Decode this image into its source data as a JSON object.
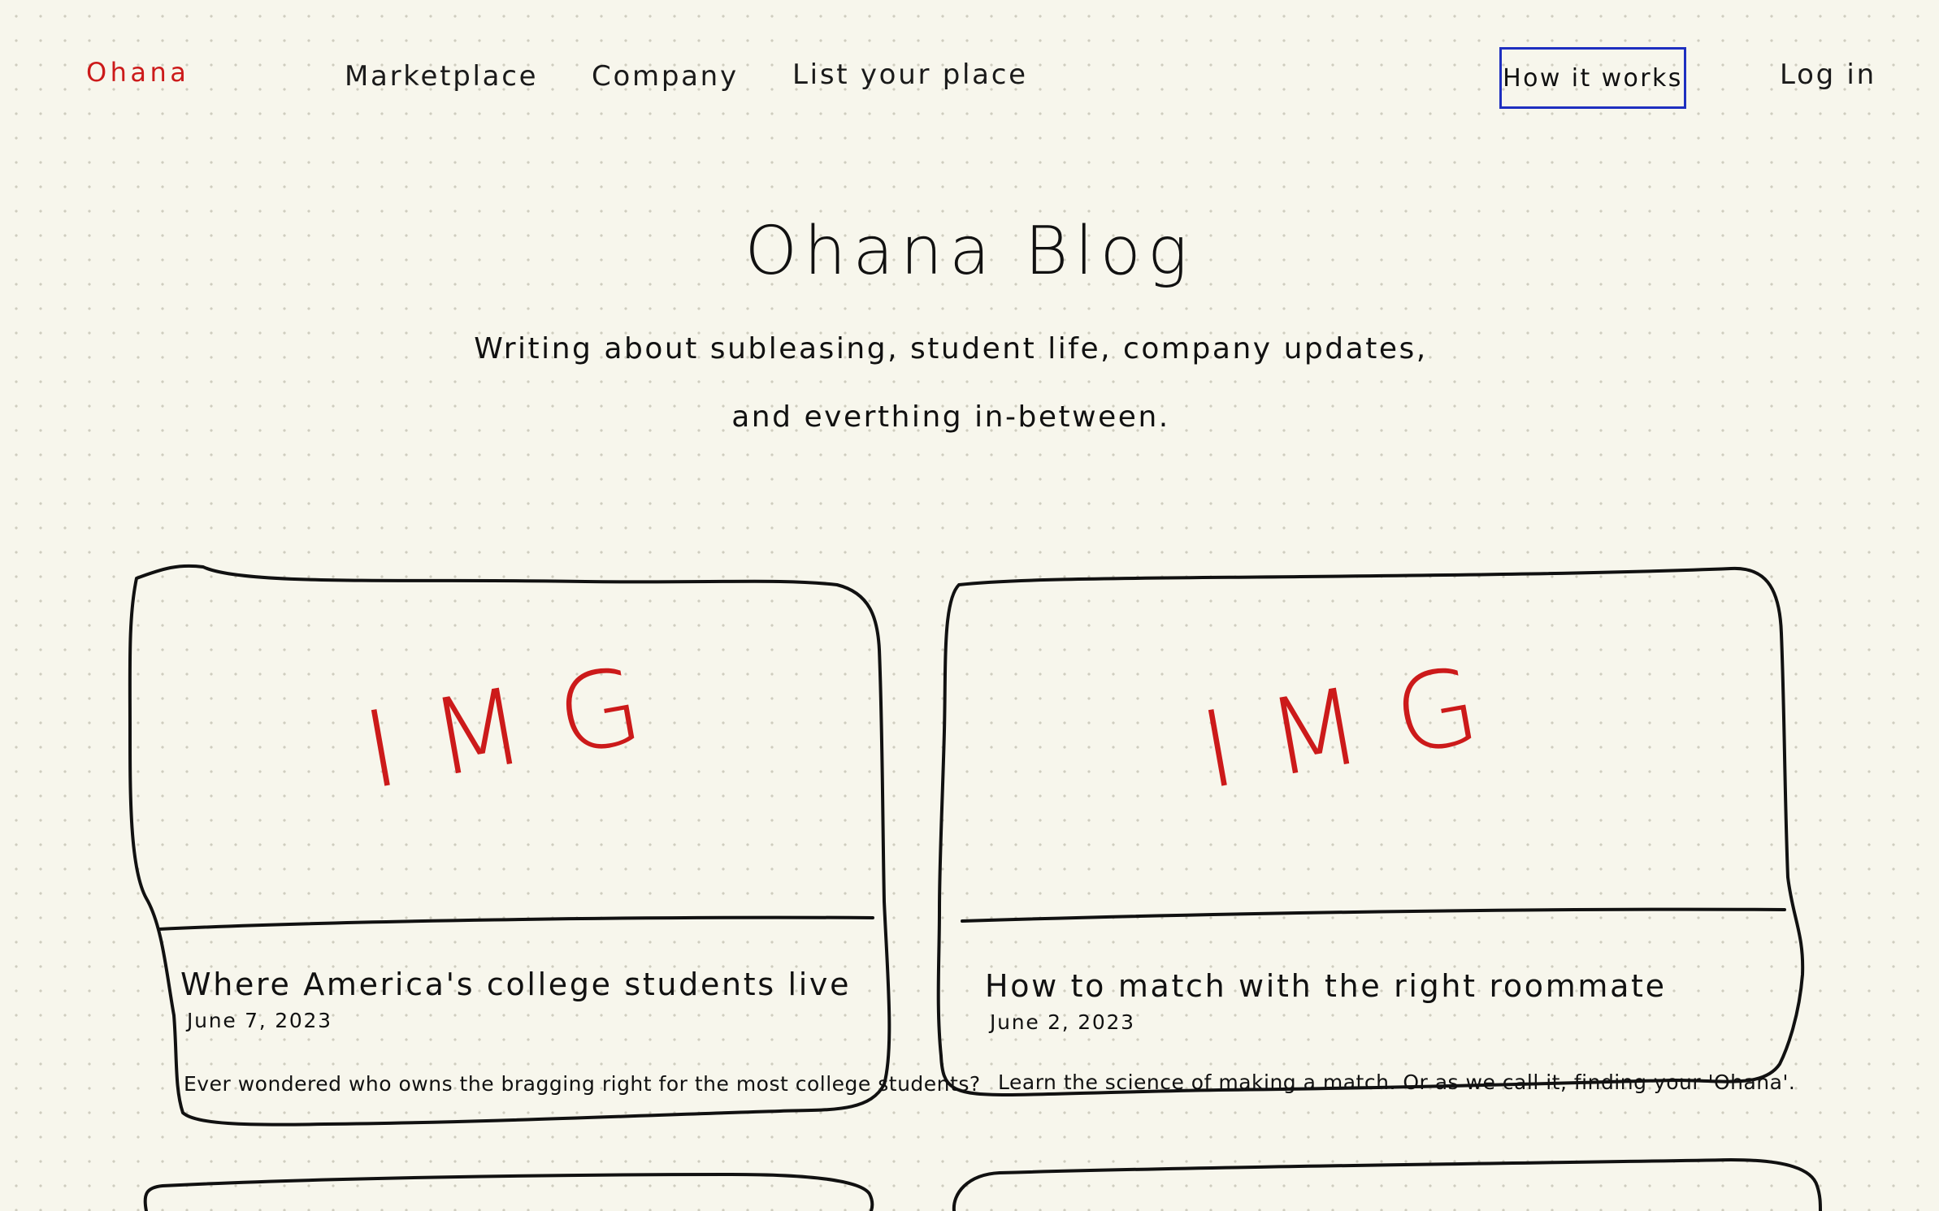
{
  "nav": {
    "logo": "Ohana",
    "links": [
      "Marketplace",
      "Company",
      "List your place"
    ],
    "how_it_works": "How it works",
    "login": "Log in"
  },
  "hero": {
    "title": "Ohana Blog",
    "subtitle": "Writing about subleasing, student life, company updates, and everthing in-between."
  },
  "posts": [
    {
      "image_label": "IMG",
      "title": "Where America's college students live",
      "date": "June 7, 2023",
      "excerpt": "Ever wondered who owns the bragging right for the most college students?"
    },
    {
      "image_label": "IMG",
      "title": "How to match with the right roommate",
      "date": "June 2, 2023",
      "excerpt": "Learn the science of making a match. Or as we call it, finding your 'Ohana'."
    }
  ],
  "colors": {
    "accent_red": "#cc1a1a",
    "highlight_blue": "#1e2fc0",
    "paper": "#f7f6ec",
    "ink": "#111111"
  }
}
